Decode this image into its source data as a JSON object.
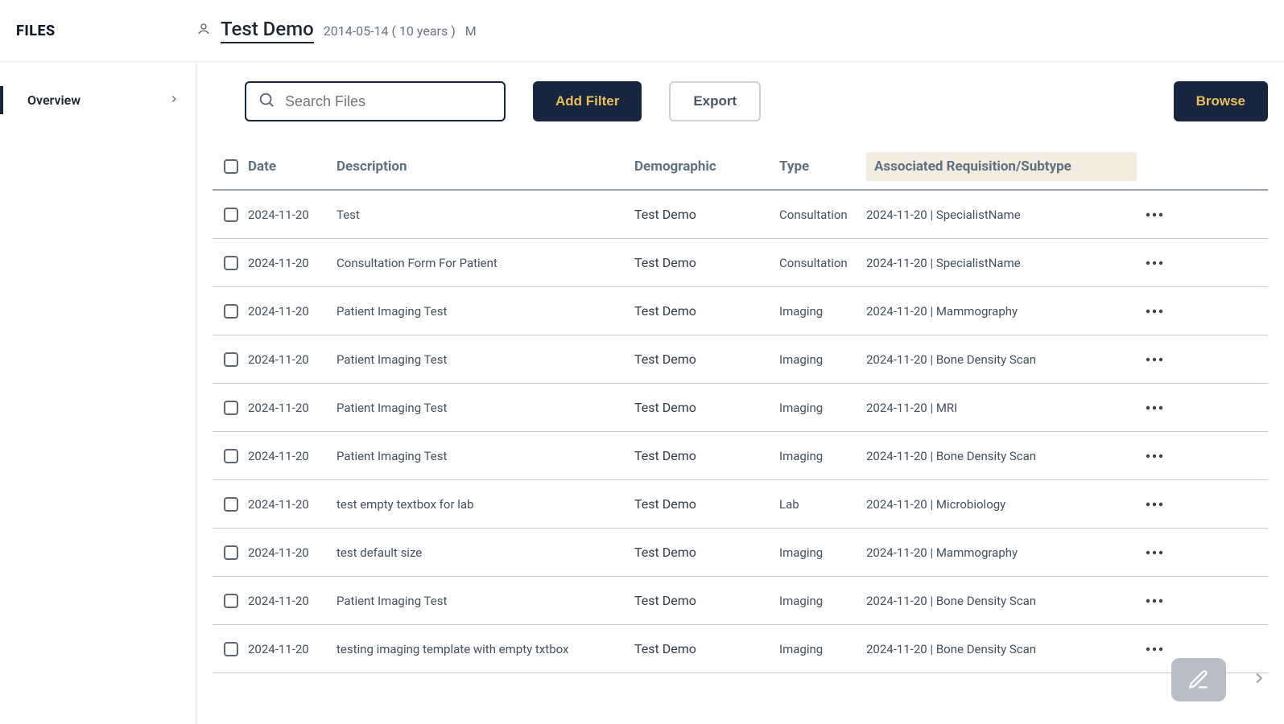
{
  "brand": "FILES",
  "patient": {
    "name": "Test Demo",
    "dob": "2014-05-14 ( 10 years )",
    "sex": "M"
  },
  "sidebar": {
    "items": [
      {
        "label": "Overview"
      }
    ]
  },
  "toolbar": {
    "search_placeholder": "Search Files",
    "add_filter": "Add Filter",
    "export": "Export",
    "browse": "Browse"
  },
  "columns": {
    "date": "Date",
    "description": "Description",
    "demographic": "Demographic",
    "type": "Type",
    "associated": "Associated Requisition/Subtype"
  },
  "rows": [
    {
      "date": "2024-11-20",
      "description": "Test",
      "demographic": "Test Demo",
      "type": "Consultation",
      "assoc": "2024-11-20 | SpecialistName"
    },
    {
      "date": "2024-11-20",
      "description": "Consultation Form For Patient",
      "demographic": "Test Demo",
      "type": "Consultation",
      "assoc": "2024-11-20 | SpecialistName"
    },
    {
      "date": "2024-11-20",
      "description": "Patient Imaging Test",
      "demographic": "Test Demo",
      "type": "Imaging",
      "assoc": "2024-11-20 | Mammography"
    },
    {
      "date": "2024-11-20",
      "description": "Patient Imaging Test",
      "demographic": "Test Demo",
      "type": "Imaging",
      "assoc": "2024-11-20 | Bone Density Scan"
    },
    {
      "date": "2024-11-20",
      "description": "Patient Imaging Test",
      "demographic": "Test Demo",
      "type": "Imaging",
      "assoc": "2024-11-20 | MRI"
    },
    {
      "date": "2024-11-20",
      "description": "Patient Imaging Test",
      "demographic": "Test Demo",
      "type": "Imaging",
      "assoc": "2024-11-20 | Bone Density Scan"
    },
    {
      "date": "2024-11-20",
      "description": "test empty textbox for lab",
      "demographic": "Test Demo",
      "type": "Lab",
      "assoc": "2024-11-20 | Microbiology"
    },
    {
      "date": "2024-11-20",
      "description": "test default size",
      "demographic": "Test Demo",
      "type": "Imaging",
      "assoc": "2024-11-20 | Mammography"
    },
    {
      "date": "2024-11-20",
      "description": "Patient Imaging Test",
      "demographic": "Test Demo",
      "type": "Imaging",
      "assoc": "2024-11-20 | Bone Density Scan"
    },
    {
      "date": "2024-11-20",
      "description": "testing imaging template with empty txtbox",
      "demographic": "Test Demo",
      "type": "Imaging",
      "assoc": "2024-11-20 | Bone Density Scan"
    }
  ]
}
